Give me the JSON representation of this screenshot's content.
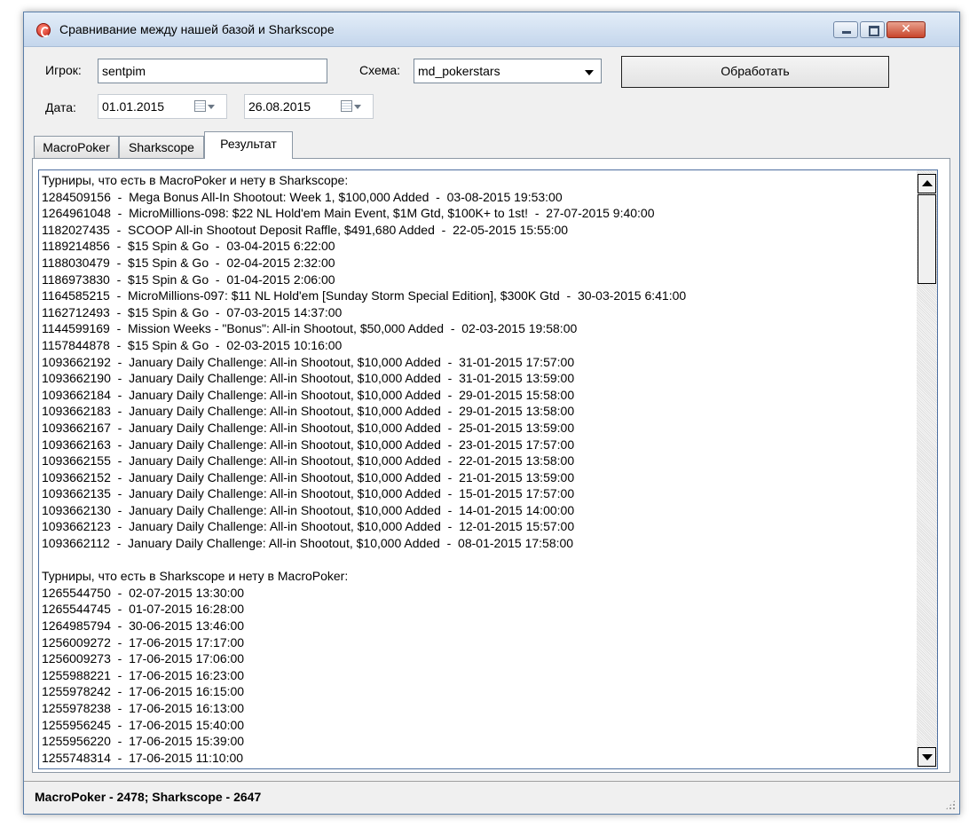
{
  "window": {
    "title": "Сравнивание между нашей базой и Sharkscope",
    "minimize_glyph": "",
    "close_glyph": "✕"
  },
  "form": {
    "player_label": "Игрок:",
    "player_value": "sentpim",
    "schema_label": "Схема:",
    "schema_value": "md_pokerstars",
    "process_label": "Обработать",
    "date_label": "Дата:",
    "date_from": "01.01.2015",
    "date_to": "26.08.2015"
  },
  "tabs": [
    {
      "label": "MacroPoker"
    },
    {
      "label": "Sharkscope"
    },
    {
      "label": "Результат"
    }
  ],
  "result_lines": [
    "Турниры, что есть в MacroPoker и нету в Sharkscope:",
    "1284509156  -  Mega Bonus All-In Shootout: Week 1, $100,000 Added  -  03-08-2015 19:53:00",
    "1264961048  -  MicroMillions-098: $22 NL Hold'em Main Event, $1M Gtd, $100K+ to 1st!  -  27-07-2015 9:40:00",
    "1182027435  -  SCOOP All-in Shootout Deposit Raffle, $491,680 Added  -  22-05-2015 15:55:00",
    "1189214856  -  $15 Spin & Go  -  03-04-2015 6:22:00",
    "1188030479  -  $15 Spin & Go  -  02-04-2015 2:32:00",
    "1186973830  -  $15 Spin & Go  -  01-04-2015 2:06:00",
    "1164585215  -  MicroMillions-097: $11 NL Hold'em [Sunday Storm Special Edition], $300K Gtd  -  30-03-2015 6:41:00",
    "1162712493  -  $15 Spin & Go  -  07-03-2015 14:37:00",
    "1144599169  -  Mission Weeks - \"Bonus\": All-in Shootout, $50,000 Added  -  02-03-2015 19:58:00",
    "1157844878  -  $15 Spin & Go  -  02-03-2015 10:16:00",
    "1093662192  -  January Daily Challenge: All-in Shootout, $10,000 Added  -  31-01-2015 17:57:00",
    "1093662190  -  January Daily Challenge: All-in Shootout, $10,000 Added  -  31-01-2015 13:59:00",
    "1093662184  -  January Daily Challenge: All-in Shootout, $10,000 Added  -  29-01-2015 15:58:00",
    "1093662183  -  January Daily Challenge: All-in Shootout, $10,000 Added  -  29-01-2015 13:58:00",
    "1093662167  -  January Daily Challenge: All-in Shootout, $10,000 Added  -  25-01-2015 13:59:00",
    "1093662163  -  January Daily Challenge: All-in Shootout, $10,000 Added  -  23-01-2015 17:57:00",
    "1093662155  -  January Daily Challenge: All-in Shootout, $10,000 Added  -  22-01-2015 13:58:00",
    "1093662152  -  January Daily Challenge: All-in Shootout, $10,000 Added  -  21-01-2015 13:59:00",
    "1093662135  -  January Daily Challenge: All-in Shootout, $10,000 Added  -  15-01-2015 17:57:00",
    "1093662130  -  January Daily Challenge: All-in Shootout, $10,000 Added  -  14-01-2015 14:00:00",
    "1093662123  -  January Daily Challenge: All-in Shootout, $10,000 Added  -  12-01-2015 15:57:00",
    "1093662112  -  January Daily Challenge: All-in Shootout, $10,000 Added  -  08-01-2015 17:58:00",
    "",
    "Турниры, что есть в Sharkscope и нету в MacroPoker:",
    "1265544750  -  02-07-2015 13:30:00",
    "1265544745  -  01-07-2015 16:28:00",
    "1264985794  -  30-06-2015 13:46:00",
    "1256009272  -  17-06-2015 17:17:00",
    "1256009273  -  17-06-2015 17:06:00",
    "1255988221  -  17-06-2015 16:23:00",
    "1255978242  -  17-06-2015 16:15:00",
    "1255978238  -  17-06-2015 16:13:00",
    "1255956245  -  17-06-2015 15:40:00",
    "1255956220  -  17-06-2015 15:39:00",
    "1255748314  -  17-06-2015 11:10:00"
  ],
  "status": {
    "text": "MacroPoker - 2478;  Sharkscope - 2647"
  },
  "icons": {
    "app": "app-logo-icon",
    "calendar": "calendar-icon",
    "dropdown": "chevron-down-icon"
  },
  "colors": {
    "title_gradient_top": "#e3edf8",
    "close_button": "#c8452b",
    "memo_border": "#4d6fa0"
  }
}
